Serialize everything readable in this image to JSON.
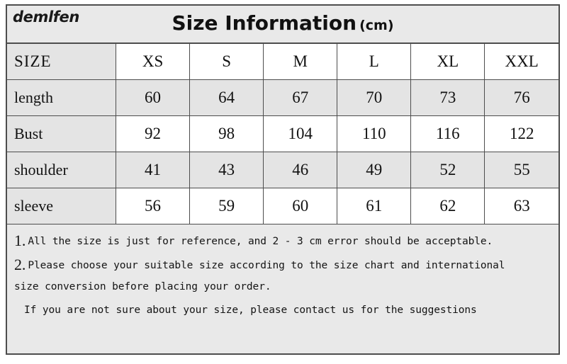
{
  "header": {
    "brand": "demlfen",
    "title": "Size Information",
    "unit": "(cm)"
  },
  "table": {
    "columns": [
      "SIZE",
      "XS",
      "S",
      "M",
      "L",
      "XL",
      "XXL"
    ],
    "rows": [
      {
        "label": "length",
        "values": [
          "60",
          "64",
          "67",
          "70",
          "73",
          "76"
        ]
      },
      {
        "label": "Bust",
        "values": [
          "92",
          "98",
          "104",
          "110",
          "116",
          "122"
        ]
      },
      {
        "label": "shoulder",
        "values": [
          "41",
          "43",
          "46",
          "49",
          "52",
          "55"
        ]
      },
      {
        "label": "sleeve",
        "values": [
          "56",
          "59",
          "60",
          "61",
          "62",
          "63"
        ]
      }
    ]
  },
  "notes": {
    "note1_num": "1.",
    "note1_text": "All the size is just for reference, and 2 - 3 cm error should be acceptable.",
    "note2_num": "2.",
    "note2_text": "Please choose your suitable size according to the size chart and international",
    "note2_text_line2": "size conversion before placing your order.",
    "note3_text": "If you are not sure about your size, please contact us for the suggestions"
  },
  "colors": {
    "card_background": "#e9e9e9",
    "cell_shaded": "#e4e4e4",
    "cell_plain": "#ffffff",
    "border": "#4d4d4d",
    "text": "#121212"
  }
}
